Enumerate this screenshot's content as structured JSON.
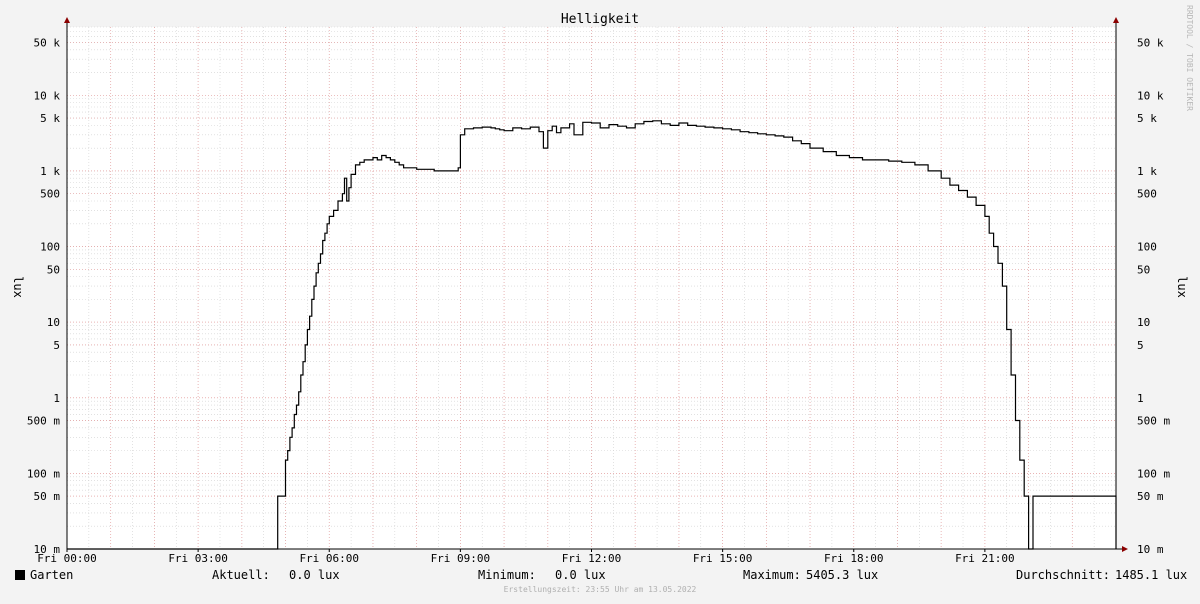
{
  "chart_data": {
    "type": "line",
    "title": "Helligkeit",
    "ylabel": "lux",
    "y_scale": "log",
    "ylim": [
      0.01,
      80000
    ],
    "xlim_hours": [
      0,
      24
    ],
    "y_ticks": [
      {
        "value": 0.01,
        "label": "10 m"
      },
      {
        "value": 0.05,
        "label": "50 m"
      },
      {
        "value": 0.1,
        "label": "100 m"
      },
      {
        "value": 0.5,
        "label": "500 m"
      },
      {
        "value": 1,
        "label": "1"
      },
      {
        "value": 5,
        "label": "5"
      },
      {
        "value": 10,
        "label": "10"
      },
      {
        "value": 50,
        "label": "50"
      },
      {
        "value": 100,
        "label": "100"
      },
      {
        "value": 500,
        "label": "500"
      },
      {
        "value": 1000,
        "label": "1 k"
      },
      {
        "value": 5000,
        "label": "5 k"
      },
      {
        "value": 10000,
        "label": "10 k"
      },
      {
        "value": 50000,
        "label": "50 k"
      }
    ],
    "x_ticks": [
      {
        "hour": 0,
        "label": "Fri 00:00"
      },
      {
        "hour": 3,
        "label": "Fri 03:00"
      },
      {
        "hour": 6,
        "label": "Fri 06:00"
      },
      {
        "hour": 9,
        "label": "Fri 09:00"
      },
      {
        "hour": 12,
        "label": "Fri 12:00"
      },
      {
        "hour": 15,
        "label": "Fri 15:00"
      },
      {
        "hour": 18,
        "label": "Fri 18:00"
      },
      {
        "hour": 21,
        "label": "Fri 21:00"
      }
    ],
    "series": [
      {
        "name": "Garten",
        "color": "#000000",
        "x_hours": [
          0,
          4.8,
          4.82,
          4.95,
          5.0,
          5.05,
          5.1,
          5.15,
          5.2,
          5.25,
          5.3,
          5.35,
          5.4,
          5.45,
          5.5,
          5.55,
          5.6,
          5.65,
          5.7,
          5.75,
          5.8,
          5.85,
          5.9,
          5.95,
          6.0,
          6.1,
          6.2,
          6.3,
          6.35,
          6.4,
          6.45,
          6.5,
          6.6,
          6.7,
          6.8,
          6.9,
          7.0,
          7.1,
          7.2,
          7.3,
          7.4,
          7.5,
          7.6,
          7.7,
          7.8,
          8.0,
          8.2,
          8.4,
          8.6,
          8.8,
          8.95,
          9.0,
          9.1,
          9.3,
          9.5,
          9.7,
          9.8,
          9.9,
          10.0,
          10.2,
          10.4,
          10.6,
          10.8,
          10.9,
          11.0,
          11.1,
          11.2,
          11.3,
          11.5,
          11.6,
          11.8,
          12.0,
          12.2,
          12.4,
          12.6,
          12.8,
          13.0,
          13.2,
          13.4,
          13.6,
          13.8,
          14.0,
          14.2,
          14.4,
          14.6,
          14.8,
          15.0,
          15.2,
          15.4,
          15.6,
          15.8,
          16.0,
          16.2,
          16.4,
          16.6,
          16.8,
          17.0,
          17.3,
          17.6,
          17.9,
          18.2,
          18.5,
          18.8,
          19.1,
          19.4,
          19.7,
          20.0,
          20.2,
          20.4,
          20.6,
          20.8,
          21.0,
          21.1,
          21.2,
          21.3,
          21.4,
          21.5,
          21.6,
          21.7,
          21.8,
          21.9,
          22.0,
          22.1,
          22.2,
          22.3,
          22.4,
          22.5,
          22.6,
          22.7,
          22.75,
          22.8,
          22.85,
          22.9,
          22.95,
          23.0,
          23.8,
          23.9,
          24.0
        ],
        "values": [
          0.01,
          0.01,
          0.05,
          0.05,
          0.15,
          0.2,
          0.3,
          0.4,
          0.6,
          0.8,
          1.2,
          2,
          3,
          5,
          8,
          12,
          20,
          30,
          45,
          60,
          80,
          120,
          150,
          200,
          250,
          300,
          400,
          500,
          800,
          400,
          600,
          900,
          1200,
          1300,
          1400,
          1400,
          1500,
          1400,
          1600,
          1500,
          1400,
          1300,
          1200,
          1100,
          1100,
          1050,
          1050,
          1000,
          1000,
          1000,
          1100,
          3000,
          3600,
          3700,
          3800,
          3700,
          3600,
          3500,
          3400,
          3700,
          3600,
          3800,
          3300,
          2000,
          3400,
          3900,
          3200,
          3700,
          4200,
          3000,
          4400,
          4300,
          3700,
          4100,
          3900,
          3700,
          4200,
          4500,
          4600,
          4200,
          4000,
          4300,
          4000,
          3900,
          3800,
          3700,
          3600,
          3500,
          3300,
          3200,
          3100,
          3000,
          2900,
          2800,
          2500,
          2300,
          2000,
          1800,
          1600,
          1500,
          1400,
          1400,
          1350,
          1300,
          1200,
          1000,
          800,
          650,
          550,
          450,
          350,
          250,
          150,
          100,
          60,
          30,
          8,
          2,
          0.5,
          0.15,
          0.05,
          0.01,
          0.05,
          0.05,
          0.05,
          0.05,
          0.05,
          0.05,
          0.05,
          0.05,
          0.05,
          0.05,
          0.05,
          0.05,
          0.05,
          0.05,
          0.05,
          0.01
        ]
      }
    ]
  },
  "legend": {
    "series_name": "Garten",
    "aktuell_label": "Aktuell:",
    "aktuell_value": "0.0 lux",
    "minimum_label": "Minimum:",
    "minimum_value": "0.0 lux",
    "maximum_label": "Maximum:",
    "maximum_value": "5405.3 lux",
    "durchschnitt_label": "Durchschnitt:",
    "durchschnitt_value": "1485.1 lux"
  },
  "footer": {
    "created": "Erstellungszeit: 23:55 Uhr am 13.05.2022"
  },
  "watermark": "RRDTOOL / TOBI OETIKER",
  "colors": {
    "background": "#f3f3f3",
    "plot_bg": "#ffffff",
    "major_grid": "#e6a0a0",
    "minor_grid": "#d0d0d0",
    "axis_arrow": "#8b0000"
  }
}
